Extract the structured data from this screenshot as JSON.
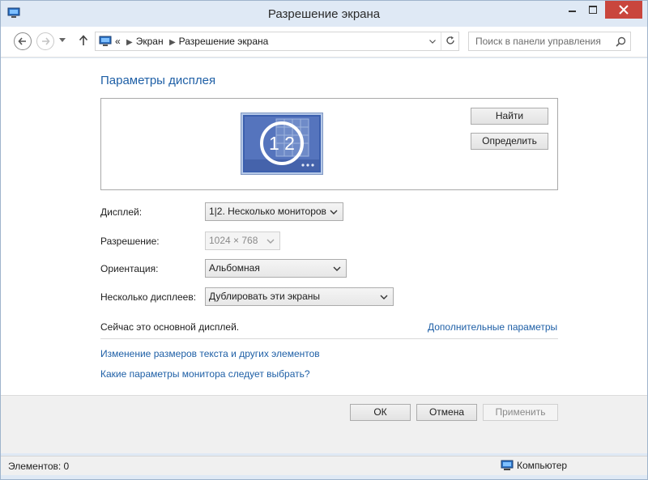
{
  "window": {
    "title": "Разрешение экрана"
  },
  "nav": {
    "breadcrumb_overflow": "«",
    "breadcrumb": [
      "Экран",
      "Разрешение экрана"
    ],
    "search_placeholder": "Поиск в панели управления"
  },
  "main": {
    "heading": "Параметры дисплея",
    "find_button": "Найти",
    "identify_button": "Определить",
    "monitor_label": "1 2",
    "display_label": "Дисплей:",
    "display_value": "1|2. Несколько мониторов",
    "resolution_label": "Разрешение:",
    "resolution_value": "1024 × 768",
    "orientation_label": "Ориентация:",
    "orientation_value": "Альбомная",
    "multi_label": "Несколько дисплеев:",
    "multi_value": "Дублировать эти экраны",
    "primary_status": "Сейчас это основной дисплей.",
    "advanced_link": "Дополнительные параметры",
    "resize_link": "Изменение размеров текста и других элементов",
    "which_link": "Какие параметры монитора следует выбрать?"
  },
  "footer": {
    "ok": "ОК",
    "cancel": "Отмена",
    "apply": "Применить"
  },
  "statusbar": {
    "items_count": "Элементов: 0",
    "location": "Компьютер"
  },
  "colors": {
    "link": "#1e5fa6",
    "close_button": "#c9463d",
    "monitor_blue": "#3b5fae"
  }
}
